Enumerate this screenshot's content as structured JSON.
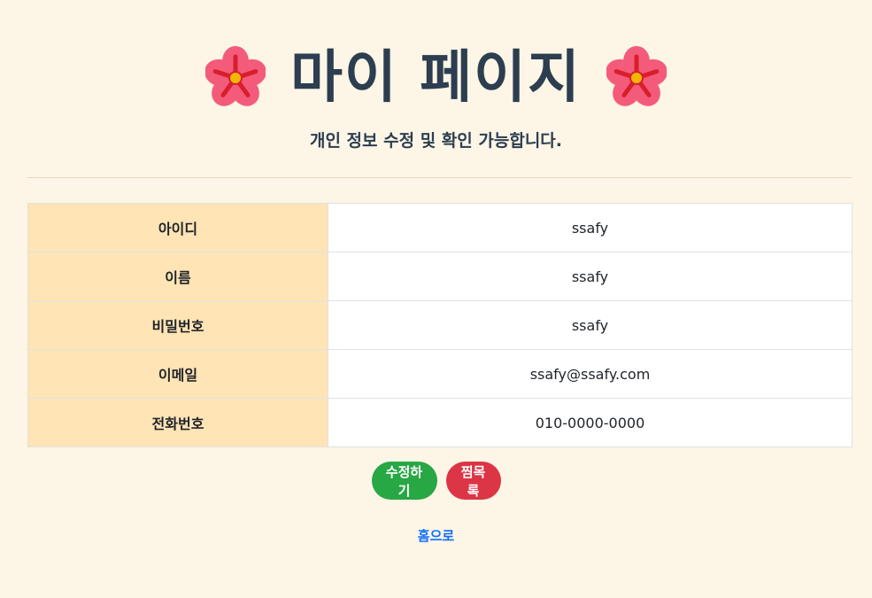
{
  "header": {
    "title": "마이 페이지",
    "subtitle": "개인 정보 수정 및 확인 가능합니다.",
    "decoration_icon": "hibiscus-flower-icon"
  },
  "profile": {
    "rows": [
      {
        "label": "아이디",
        "value": "ssafy"
      },
      {
        "label": "이름",
        "value": "ssafy"
      },
      {
        "label": "비밀번호",
        "value": "ssafy"
      },
      {
        "label": "이메일",
        "value": "ssafy@ssafy.com"
      },
      {
        "label": "전화번호",
        "value": "010-0000-0000"
      }
    ]
  },
  "actions": {
    "edit_label": "수정하기",
    "wishlist_label": "찜목록"
  },
  "nav": {
    "home_label": "홈으로"
  },
  "colors": {
    "page_background": "#fdf5e6",
    "label_cell_background": "#ffe4b5",
    "edit_button": "#28a745",
    "wishlist_button": "#dc3545",
    "link": "#0d6efd",
    "title_text": "#2c3e50"
  }
}
